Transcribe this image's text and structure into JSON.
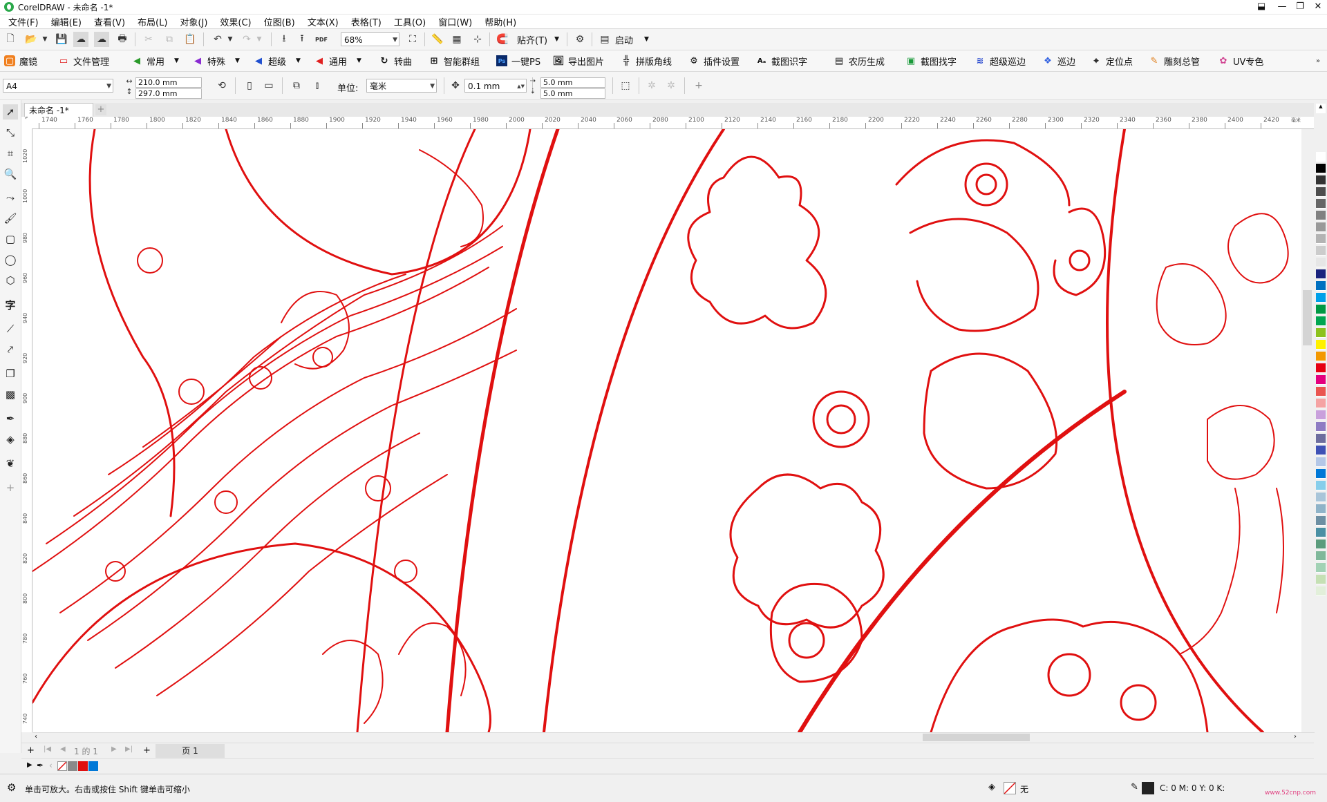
{
  "window": {
    "title": "CorelDRAW - 未命名 -1*"
  },
  "window_buttons": [
    "⬓",
    "—",
    "❐",
    "✕"
  ],
  "menu": [
    "文件(F)",
    "编辑(E)",
    "查看(V)",
    "布局(L)",
    "对象(J)",
    "效果(C)",
    "位图(B)",
    "文本(X)",
    "表格(T)",
    "工具(O)",
    "窗口(W)",
    "帮助(H)"
  ],
  "toolbar1": {
    "zoom": "68%",
    "snap_label": "贴齐(T)",
    "launch_label": "启动"
  },
  "plugin_bar": [
    "魔镜",
    "文件管理",
    "常用",
    "特殊",
    "超级",
    "通用",
    "转曲",
    "智能群组",
    "一键PS",
    "导出图片",
    "拼版角线",
    "插件设置",
    "截图识字",
    "农历生成",
    "截图找字",
    "超级巡边",
    "巡边",
    "定位点",
    "雕刻总管",
    "UV专色"
  ],
  "property_bar": {
    "page_size": "A4",
    "width": "210.0 mm",
    "height": "297.0 mm",
    "units_label": "单位:",
    "units_value": "毫米",
    "nudge": "0.1 mm",
    "dup_x": "5.0 mm",
    "dup_y": "5.0 mm"
  },
  "document_tab": "未命名 -1*",
  "ruler": {
    "h_ticks": [
      "1740",
      "1760",
      "1780",
      "1800",
      "1820",
      "1840",
      "1860",
      "1880",
      "1900",
      "1920",
      "1940",
      "1960",
      "1980",
      "2000",
      "2020",
      "2040",
      "2060",
      "2080",
      "2100",
      "2120",
      "2140",
      "2160",
      "2180",
      "2200",
      "2220",
      "2240",
      "2260",
      "2280",
      "2300",
      "2320",
      "2340",
      "2360",
      "2380",
      "2400",
      "2420"
    ],
    "h_unit": "毫米",
    "v_ticks": [
      "1020",
      "1000",
      "980",
      "960",
      "940",
      "920",
      "900",
      "880",
      "860",
      "840",
      "820",
      "800",
      "780",
      "760",
      "740"
    ]
  },
  "page_nav": {
    "counter": "1 的 1",
    "page_tab": "页 1"
  },
  "status": {
    "hint": "单击可放大。右击或按住 Shift 键单击可缩小",
    "fill_label": "无",
    "cmyk": "C: 0 M: 0 Y: 0 K:",
    "watermark": "www.52cnp.com"
  },
  "colors": {
    "accent": "#1e90ff",
    "drawing_stroke": "#e01010",
    "palette": [
      "#ffffff",
      "#000000",
      "#333333",
      "#4d4d4d",
      "#666666",
      "#808080",
      "#999999",
      "#b3b3b3",
      "#cccccc",
      "#e6e6e6",
      "#1a237e",
      "#0070c0",
      "#00a0e9",
      "#009944",
      "#00a651",
      "#8dc21f",
      "#fff100",
      "#f39800",
      "#e60012",
      "#e4007f",
      "#ea5550",
      "#f5a3a3",
      "#c9a0dc",
      "#8e7cc3",
      "#6d6d9e",
      "#3f51b5",
      "#b4c7e7",
      "#0078d7",
      "#87ceeb",
      "#a9c5d9",
      "#8fb3c8",
      "#6d8fa3",
      "#4a90a4",
      "#5b9c7d",
      "#7fb89a",
      "#a2d2b5",
      "#c5e0b4",
      "#e2efda"
    ]
  }
}
